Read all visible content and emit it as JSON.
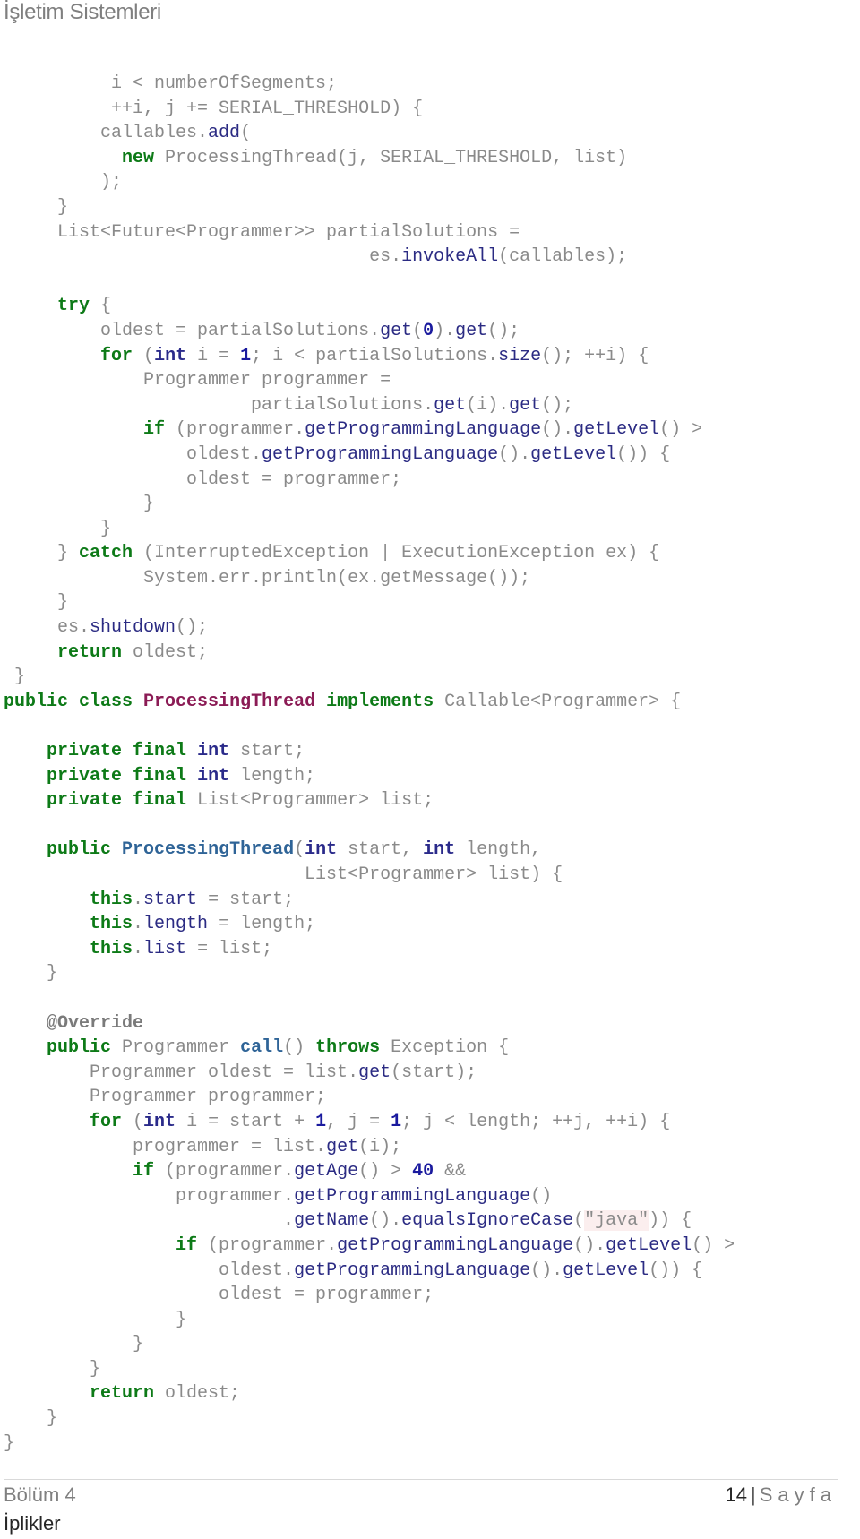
{
  "header": {
    "title": "İşletim Sistemleri"
  },
  "code_lines": [
    [
      [
        "p",
        "          i < numberOfSegments;"
      ]
    ],
    [
      [
        "p",
        "          ++i, j += SERIAL_THRESHOLD) {"
      ]
    ],
    [
      [
        "p",
        "         callables."
      ],
      [
        "fn",
        "add"
      ],
      [
        "p",
        "("
      ]
    ],
    [
      [
        "p",
        "           "
      ],
      [
        "kw",
        "new"
      ],
      [
        "p",
        " ProcessingThread(j, SERIAL_THRESHOLD, list)"
      ]
    ],
    [
      [
        "p",
        "         );"
      ]
    ],
    [
      [
        "p",
        "     }"
      ]
    ],
    [
      [
        "p",
        "     List<Future<Programmer>> partialSolutions ="
      ]
    ],
    [
      [
        "p",
        "                                  es."
      ],
      [
        "fn",
        "invokeAll"
      ],
      [
        "p",
        "(callables);"
      ]
    ],
    [
      [
        "p",
        ""
      ]
    ],
    [
      [
        "p",
        "     "
      ],
      [
        "kw",
        "try"
      ],
      [
        "p",
        " {"
      ]
    ],
    [
      [
        "p",
        "         oldest = partialSolutions."
      ],
      [
        "fn",
        "get"
      ],
      [
        "p",
        "("
      ],
      [
        "num",
        "0"
      ],
      [
        "p",
        ")."
      ],
      [
        "fn",
        "get"
      ],
      [
        "p",
        "();"
      ]
    ],
    [
      [
        "p",
        "         "
      ],
      [
        "kw",
        "for"
      ],
      [
        "p",
        " ("
      ],
      [
        "ty",
        "int"
      ],
      [
        "p",
        " i = "
      ],
      [
        "num",
        "1"
      ],
      [
        "p",
        "; i < partialSolutions."
      ],
      [
        "fn",
        "size"
      ],
      [
        "p",
        "(); ++i) {"
      ]
    ],
    [
      [
        "p",
        "             Programmer programmer ="
      ]
    ],
    [
      [
        "p",
        "                       partialSolutions."
      ],
      [
        "fn",
        "get"
      ],
      [
        "p",
        "(i)."
      ],
      [
        "fn",
        "get"
      ],
      [
        "p",
        "();"
      ]
    ],
    [
      [
        "p",
        "             "
      ],
      [
        "kw",
        "if"
      ],
      [
        "p",
        " (programmer."
      ],
      [
        "fn",
        "getProgrammingLanguage"
      ],
      [
        "p",
        "()."
      ],
      [
        "fn",
        "getLevel"
      ],
      [
        "p",
        "() >"
      ]
    ],
    [
      [
        "p",
        "                 oldest."
      ],
      [
        "fn",
        "getProgrammingLanguage"
      ],
      [
        "p",
        "()."
      ],
      [
        "fn",
        "getLevel"
      ],
      [
        "p",
        "()) {"
      ]
    ],
    [
      [
        "p",
        "                 oldest = programmer;"
      ]
    ],
    [
      [
        "p",
        "             }"
      ]
    ],
    [
      [
        "p",
        "         }"
      ]
    ],
    [
      [
        "p",
        "     } "
      ],
      [
        "kw",
        "catch"
      ],
      [
        "p",
        " (InterruptedException | ExecutionException ex) {"
      ]
    ],
    [
      [
        "p",
        "             System.err.println(ex.getMessage());"
      ]
    ],
    [
      [
        "p",
        "     }"
      ]
    ],
    [
      [
        "p",
        "     es."
      ],
      [
        "fn",
        "shutdown"
      ],
      [
        "p",
        "();"
      ]
    ],
    [
      [
        "p",
        "     "
      ],
      [
        "kw",
        "return"
      ],
      [
        "p",
        " oldest;"
      ]
    ],
    [
      [
        "p",
        " }"
      ]
    ],
    [
      [
        "kw",
        "public class"
      ],
      [
        "p",
        " "
      ],
      [
        "cls",
        "ProcessingThread"
      ],
      [
        "p",
        " "
      ],
      [
        "kw",
        "implements"
      ],
      [
        "p",
        " Callable<Programmer> {"
      ]
    ],
    [
      [
        "p",
        ""
      ]
    ],
    [
      [
        "p",
        "    "
      ],
      [
        "kw",
        "private final"
      ],
      [
        "p",
        " "
      ],
      [
        "ty",
        "int"
      ],
      [
        "p",
        " start;"
      ]
    ],
    [
      [
        "p",
        "    "
      ],
      [
        "kw",
        "private final"
      ],
      [
        "p",
        " "
      ],
      [
        "ty",
        "int"
      ],
      [
        "p",
        " length;"
      ]
    ],
    [
      [
        "p",
        "    "
      ],
      [
        "kw",
        "private final"
      ],
      [
        "p",
        " List<Programmer> list;"
      ]
    ],
    [
      [
        "p",
        ""
      ]
    ],
    [
      [
        "p",
        "    "
      ],
      [
        "kw",
        "public"
      ],
      [
        "p",
        " "
      ],
      [
        "decl",
        "ProcessingThread"
      ],
      [
        "p",
        "("
      ],
      [
        "ty",
        "int"
      ],
      [
        "p",
        " start, "
      ],
      [
        "ty",
        "int"
      ],
      [
        "p",
        " length,"
      ]
    ],
    [
      [
        "p",
        "                            List<Programmer> list) {"
      ]
    ],
    [
      [
        "p",
        "        "
      ],
      [
        "kw",
        "this"
      ],
      [
        "p",
        "."
      ],
      [
        "fn",
        "start"
      ],
      [
        "p",
        " = start;"
      ]
    ],
    [
      [
        "p",
        "        "
      ],
      [
        "kw",
        "this"
      ],
      [
        "p",
        "."
      ],
      [
        "fn",
        "length"
      ],
      [
        "p",
        " = length;"
      ]
    ],
    [
      [
        "p",
        "        "
      ],
      [
        "kw",
        "this"
      ],
      [
        "p",
        "."
      ],
      [
        "fn",
        "list"
      ],
      [
        "p",
        " = list;"
      ]
    ],
    [
      [
        "p",
        "    }"
      ]
    ],
    [
      [
        "p",
        ""
      ]
    ],
    [
      [
        "p",
        "    "
      ],
      [
        "ann",
        "@Override"
      ]
    ],
    [
      [
        "p",
        "    "
      ],
      [
        "kw",
        "public"
      ],
      [
        "p",
        " Programmer "
      ],
      [
        "decl",
        "call"
      ],
      [
        "p",
        "() "
      ],
      [
        "kw",
        "throws"
      ],
      [
        "p",
        " Exception {"
      ]
    ],
    [
      [
        "p",
        "        Programmer oldest = list."
      ],
      [
        "fn",
        "get"
      ],
      [
        "p",
        "(start);"
      ]
    ],
    [
      [
        "p",
        "        Programmer programmer;"
      ]
    ],
    [
      [
        "p",
        "        "
      ],
      [
        "kw",
        "for"
      ],
      [
        "p",
        " ("
      ],
      [
        "ty",
        "int"
      ],
      [
        "p",
        " i = start + "
      ],
      [
        "num",
        "1"
      ],
      [
        "p",
        ", j = "
      ],
      [
        "num",
        "1"
      ],
      [
        "p",
        "; j < length; ++j, ++i) {"
      ]
    ],
    [
      [
        "p",
        "            programmer = list."
      ],
      [
        "fn",
        "get"
      ],
      [
        "p",
        "(i);"
      ]
    ],
    [
      [
        "p",
        "            "
      ],
      [
        "kw",
        "if"
      ],
      [
        "p",
        " (programmer."
      ],
      [
        "fn",
        "getAge"
      ],
      [
        "p",
        "() > "
      ],
      [
        "num",
        "40"
      ],
      [
        "p",
        " &&"
      ]
    ],
    [
      [
        "p",
        "                programmer."
      ],
      [
        "fn",
        "getProgrammingLanguage"
      ],
      [
        "p",
        "()"
      ]
    ],
    [
      [
        "p",
        "                          ."
      ],
      [
        "fn",
        "getName"
      ],
      [
        "p",
        "()."
      ],
      [
        "fn",
        "equalsIgnoreCase"
      ],
      [
        "p",
        "("
      ],
      [
        "str",
        "\"java\""
      ],
      [
        "p",
        ")) {"
      ]
    ],
    [
      [
        "p",
        "                "
      ],
      [
        "kw",
        "if"
      ],
      [
        "p",
        " (programmer."
      ],
      [
        "fn",
        "getProgrammingLanguage"
      ],
      [
        "p",
        "()."
      ],
      [
        "fn",
        "getLevel"
      ],
      [
        "p",
        "() >"
      ]
    ],
    [
      [
        "p",
        "                    oldest."
      ],
      [
        "fn",
        "getProgrammingLanguage"
      ],
      [
        "p",
        "()."
      ],
      [
        "fn",
        "getLevel"
      ],
      [
        "p",
        "()) {"
      ]
    ],
    [
      [
        "p",
        "                    oldest = programmer;"
      ]
    ],
    [
      [
        "p",
        "                }"
      ]
    ],
    [
      [
        "p",
        "            }"
      ]
    ],
    [
      [
        "p",
        "        }"
      ]
    ],
    [
      [
        "p",
        "        "
      ],
      [
        "kw",
        "return"
      ],
      [
        "p",
        " oldest;"
      ]
    ],
    [
      [
        "p",
        "    }"
      ]
    ],
    [
      [
        "p",
        "}"
      ]
    ]
  ],
  "footer": {
    "chapter": "Bölüm 4",
    "chapter_title": "İplikler",
    "page_number": "14",
    "separator": "|",
    "page_label": "Sayfa"
  }
}
